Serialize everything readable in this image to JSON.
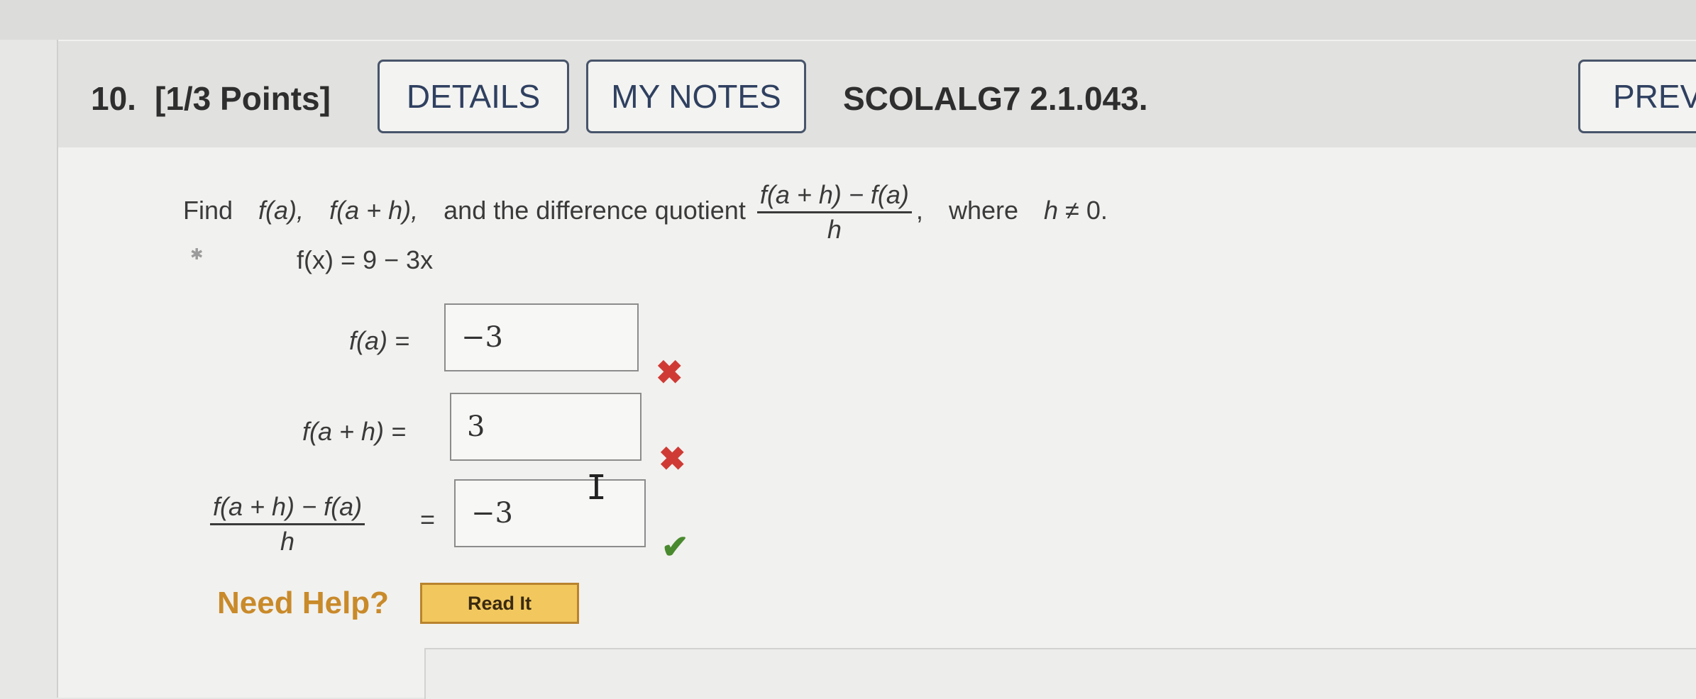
{
  "header": {
    "question_number": "10.",
    "points": "[1/3 Points]",
    "details_label": "DETAILS",
    "my_notes_label": "MY NOTES",
    "code": "SCOLALG7 2.1.043.",
    "preview_label": "PREVIO"
  },
  "prompt": {
    "find": "Find",
    "fa": "f(a),",
    "fah": "f(a + h),",
    "and_text": "and the difference quotient",
    "frac_num": "f(a + h) − f(a)",
    "frac_den": "h",
    "comma": ",",
    "where": "where",
    "cond_var": "h",
    "cond_rest": "≠ 0."
  },
  "function_def": "f(x) = 9 − 3x",
  "answers": [
    {
      "label": "f(a) =",
      "value": "−3",
      "status": "incorrect",
      "mark": "✖"
    },
    {
      "label": "f(a + h) =",
      "value": "3",
      "status": "incorrect",
      "mark": "✖"
    },
    {
      "label_num": "f(a + h) − f(a)",
      "label_den": "h",
      "eq": "=",
      "value": "−3",
      "status": "correct",
      "mark": "✔"
    }
  ],
  "help": {
    "need_help": "Need Help?",
    "read_it": "Read It"
  },
  "colors": {
    "incorrect": "#cf3b34",
    "correct": "#4a8a2e",
    "button_border": "#47546a",
    "help_text": "#c98a2a",
    "read_it_bg": "#f2c85e"
  },
  "icons": {
    "incorrect": "x-mark-icon",
    "correct": "check-mark-icon",
    "cursor": "text-cursor-icon"
  }
}
